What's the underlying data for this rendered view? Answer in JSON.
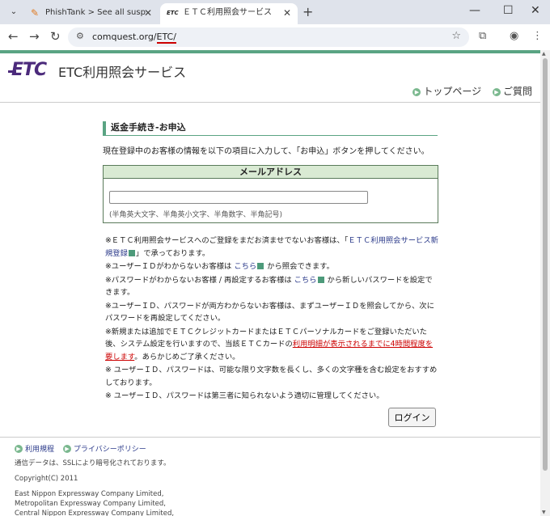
{
  "browser": {
    "tabs": [
      {
        "title": "PhishTank > See all suspected p",
        "active": false
      },
      {
        "title": "ＥＴＣ利用照会サービス",
        "active": true
      }
    ],
    "url_prefix": "comquest.org/",
    "url_highlight": "ETC/",
    "favicon_etc": "ETC"
  },
  "header": {
    "logo": "ETC",
    "service_title": "ETC利用照会サービス",
    "links": {
      "top": "トップページ",
      "faq": "ご質問"
    }
  },
  "form": {
    "section_title": "返金手続き-お申込",
    "description": "現在登録中のお客様の情報を以下の項目に入力して、「お申込」ボタンを押してください。",
    "mail_header": "メールアドレス",
    "mail_value": "",
    "mail_hint": "(半角英大文字、半角英小文字、半角数字、半角記号)"
  },
  "notes": {
    "n1_pre": "※ＥＴＣ利用照会サービスへのご登録をまだお済ませでないお客様は、「",
    "n1_link": "ＥＴＣ利用照会サービス新規登録",
    "n1_post": "」で承っております。",
    "n2_pre": "※ユーザーＩＤがわからないお客様は ",
    "n2_link": "こちら",
    "n2_post": " から照会できます。",
    "n3_pre": "※パスワードがわからないお客様 / 再設定するお客様は ",
    "n3_link": "こちら",
    "n3_post": " から新しいパスワードを設定できます。",
    "n4": "※ユーザーＩＤ、パスワードが両方わからないお客様は、まずユーザーＩＤを照会してから、次にパスワードを再設定してください。",
    "n5_pre": "※新規または追加でＥＴＣクレジットカードまたはＥＴＣパーソナルカードをご登録いただいた後、システム設定を行いますので、当該ＥＴＣカードの",
    "n5_red": "利用明細が表示されるまでに4時間程度を要します",
    "n5_post": "。あらかじめご了承ください。",
    "n6": "※ ユーザーＩＤ、パスワードは、可能な限り文字数を長くし、多くの文字種を含む設定をおすすめしております。",
    "n7": "※ ユーザーＩＤ、パスワードは第三者に知られないよう適切に管理してください。"
  },
  "login_label": "ログイン",
  "footer": {
    "links": {
      "terms": "利用規程",
      "privacy": "プライバシーポリシー"
    },
    "ssl": "通信データは、SSLにより暗号化されております。",
    "copyright": "Copyright(C) 2011",
    "companies": [
      "East Nippon Expressway Company Limited,",
      "Metropolitan Expressway Company Limited,",
      "Central Nippon Expressway Company Limited,"
    ]
  },
  "colors": {
    "accent": "#5aa483",
    "logo": "#4b2a7b",
    "link": "#2b3a8a",
    "warning": "#cc0000"
  }
}
